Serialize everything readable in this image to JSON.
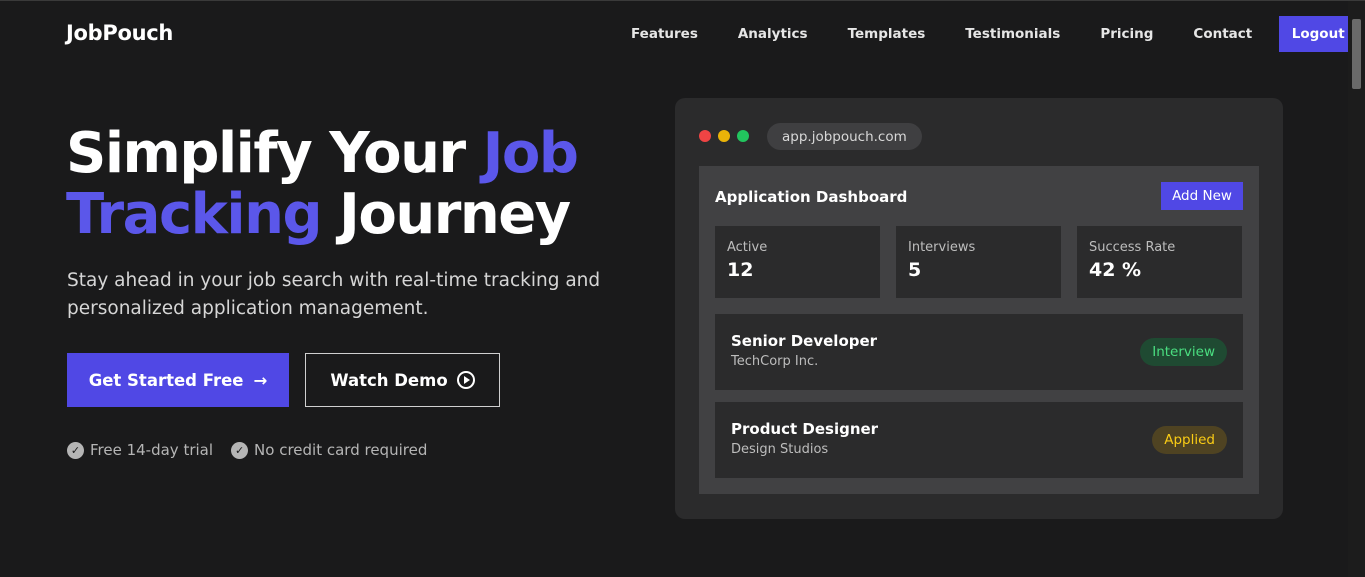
{
  "nav": {
    "logo": "JobPouch",
    "links": [
      "Features",
      "Analytics",
      "Templates",
      "Testimonials",
      "Pricing",
      "Contact"
    ],
    "logout_label": "Logout"
  },
  "hero": {
    "title_part1": "Simplify Your ",
    "title_accent1": "Job",
    "title_accent2": "Tracking",
    "title_part2": " Journey",
    "subtitle": "Stay ahead in your job search with real-time tracking and personalized application management.",
    "primary_cta": "Get Started Free",
    "primary_cta_arrow": "→",
    "secondary_cta": "Watch Demo",
    "features": [
      "Free 14-day trial",
      "No credit card required"
    ],
    "check_glyph": "✓"
  },
  "mockup": {
    "window_dot_colors": [
      "#ef4444",
      "#eab308",
      "#22c55e"
    ],
    "url": "app.jobpouch.com",
    "dashboard_title": "Application Dashboard",
    "add_new_label": "Add New",
    "stats": [
      {
        "label": "Active",
        "value": "12"
      },
      {
        "label": "Interviews",
        "value": "5"
      },
      {
        "label": "Success Rate",
        "value": "42 %"
      }
    ],
    "jobs": [
      {
        "title": "Senior Developer",
        "company": "TechCorp Inc.",
        "status": "Interview",
        "status_color": "#4ade80",
        "status_bg": "#1f4a32"
      },
      {
        "title": "Product Designer",
        "company": "Design Studios",
        "status": "Applied",
        "status_color": "#facc15",
        "status_bg": "#4f4322"
      }
    ]
  },
  "colors": {
    "accent": "#5048e5",
    "accent_text": "#5b57ea",
    "background": "#1a1a1b"
  }
}
